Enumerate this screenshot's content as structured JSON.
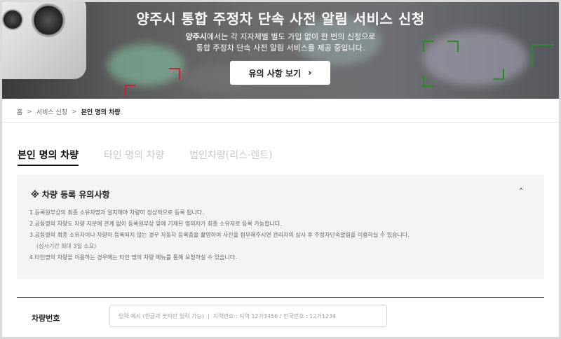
{
  "hero": {
    "title": "양주시 통합 주정차 단속 사전 알림 서비스 신청",
    "sub_line1_bold": "양주시",
    "sub_line1_rest": "에서는 각 지자체별 별도 가입 없이 한 번의 신청으로",
    "sub_line2": "통합 주정차 단속 사전 알림 서비스를 제공 중입니다.",
    "button_label": "유의 사항 보기",
    "button_icon": "chevron-right-icon"
  },
  "breadcrumb": {
    "items": [
      "홈",
      "서비스 신청",
      "본인 명의 차량"
    ]
  },
  "tabs": [
    {
      "label": "본인 명의 차량",
      "active": true
    },
    {
      "label": "타인 명의 차량",
      "active": false
    },
    {
      "label": "법인차량(리스·렌트)",
      "active": false
    }
  ],
  "notice": {
    "title": "※ 차량 등록 유의사항",
    "toggle_icon": "chevron-up-icon",
    "items": [
      "1.등록원부상의 최종 소유자명과 일치해야 차량이 정상적으로 등록 됩니다.",
      "2.공동명의 차량도 차량 지분에 관계 없이 등록원부상 앞에 기재된 명의자가 최종 소유자로 등록 가능합니다.",
      "3.공동명의 최종 소유자이나 차량이 등록되지 않는 경우 자동차 등록증을 촬영하여 사진을 첨부해주시면 관리자의 심사 후 주정차단속알림을 이용하실 수 있습니다.",
      "(심사기간 최대 3일 소요)",
      "4.타인명의 차량을 이용하는 경우에는 타인 명의 차량 메뉴를 통해 요청하실 수 있습니다."
    ]
  },
  "vehicle_field": {
    "label": "차량번호",
    "placeholder": "입력 예시 (한글과 숫자만 입력 가능)  |  지역번호 : 지역 12가3456 / 전국번호 : 12가1234"
  }
}
